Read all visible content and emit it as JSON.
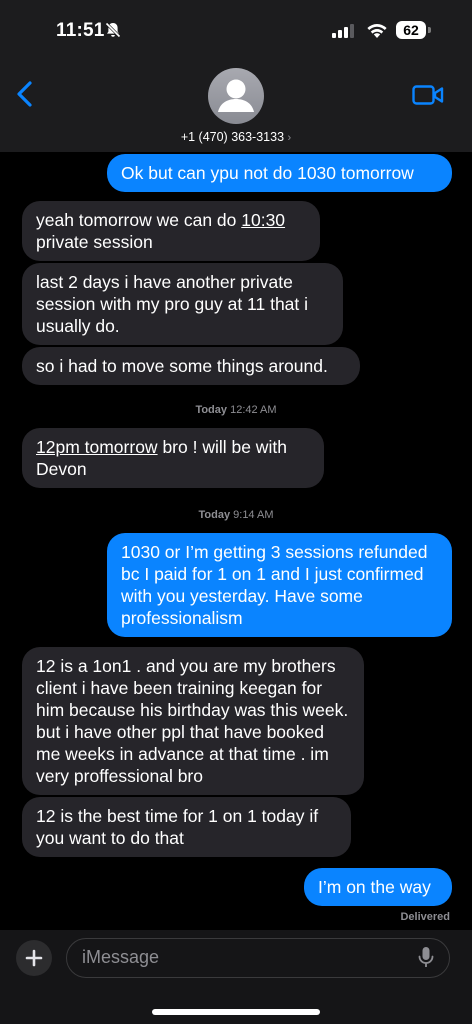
{
  "status_bar": {
    "time": "11:51",
    "battery": "62"
  },
  "header": {
    "contact": "+1 (470) 363-3133",
    "chevron": "›"
  },
  "messages": [
    {
      "text": "Ok but can ypu not do 1030 tomorrow"
    },
    {
      "underlined": "10:30",
      "line1_pre": "yeah tomorrow we can do ",
      "line2": "private session"
    },
    {
      "text": "last 2 days i have another private session with my pro guy at 11 that i usually do."
    },
    {
      "text": "so i had to move some things around."
    },
    {
      "underlined": "12pm tomorrow",
      "line1_post": " bro ! will be with",
      "line2": "Devon"
    },
    {
      "text": "1030 or I’m getting 3 sessions refunded bc I paid for 1 on 1 and I just confirmed with you yesterday. Have some professionalism"
    },
    {
      "text": "12 is a 1on1 . and you are my brothers client i have been training keegan for him because his birthday was this week. but i have other ppl that have booked me weeks in advance at that time . im very proffessional bro"
    },
    {
      "text": "12 is the best time for 1 on 1 today if you want to do that"
    },
    {
      "text": "I’m on the way"
    }
  ],
  "timestamps": [
    {
      "day": "Today",
      "time": "12:42 AM"
    },
    {
      "day": "Today",
      "time": "9:14 AM"
    }
  ],
  "delivered": "Delivered",
  "composer": {
    "placeholder": "iMessage"
  },
  "icons": [
    "back-chevron-icon",
    "avatar-person-icon",
    "video-call-icon",
    "plus-icon",
    "microphone-icon",
    "bell-slash-icon",
    "signal-icon",
    "wifi-icon",
    "battery-icon"
  ],
  "colors": {
    "outgoing": "#0a84ff",
    "incoming": "#26252a",
    "accent": "#0a84ff",
    "background": "#000000"
  }
}
